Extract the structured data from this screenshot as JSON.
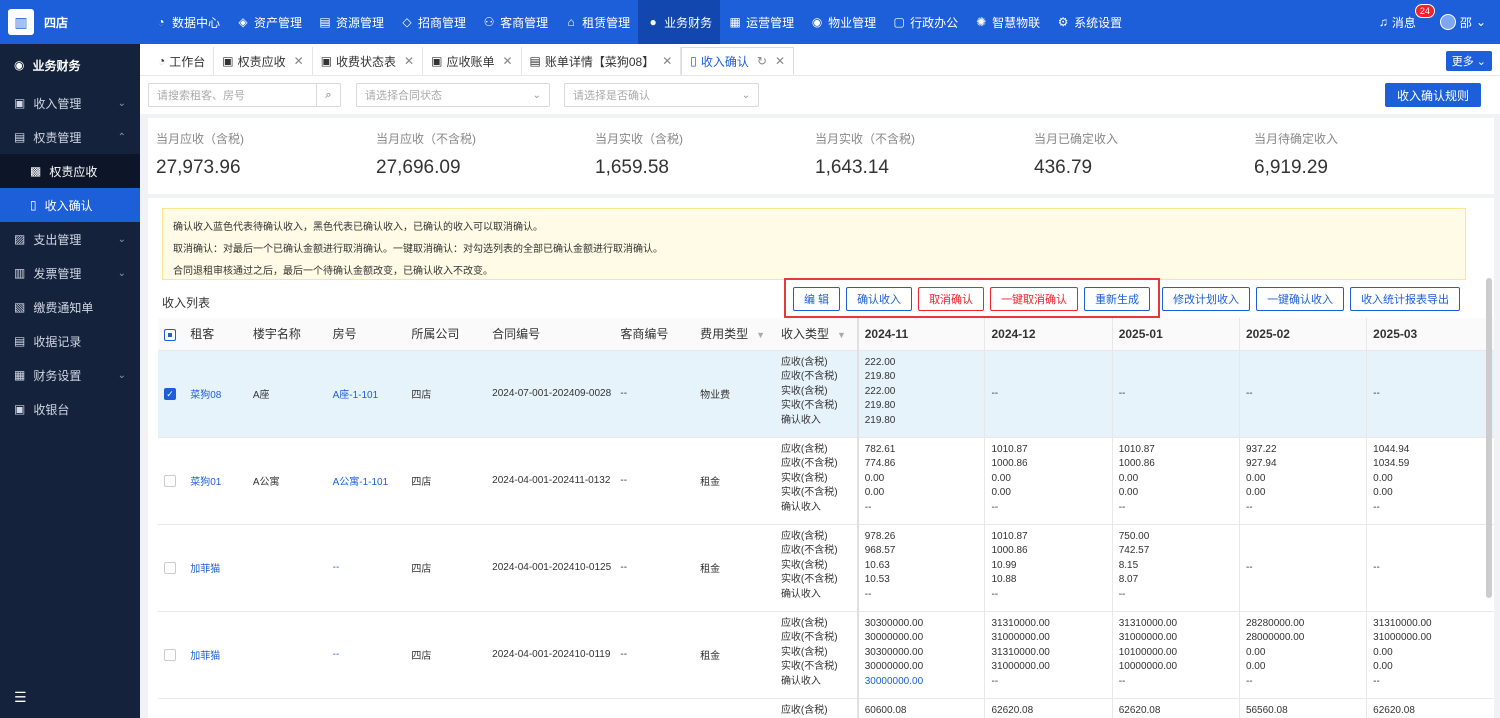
{
  "app": {
    "name": "四店",
    "logo_icon": "building-icon"
  },
  "topnav": [
    {
      "icon": "◔",
      "label": "数据中心"
    },
    {
      "icon": "◈",
      "label": "资产管理"
    },
    {
      "icon": "▤",
      "label": "资源管理"
    },
    {
      "icon": "◇",
      "label": "招商管理"
    },
    {
      "icon": "⚇",
      "label": "客商管理"
    },
    {
      "icon": "⌂",
      "label": "租赁管理"
    },
    {
      "icon": "●",
      "label": "业务财务"
    },
    {
      "icon": "▦",
      "label": "运营管理"
    },
    {
      "icon": "◉",
      "label": "物业管理"
    },
    {
      "icon": "▢",
      "label": "行政办公"
    },
    {
      "icon": "✺",
      "label": "智慧物联"
    },
    {
      "icon": "⚙",
      "label": "系统设置"
    }
  ],
  "topright": {
    "message": "消息",
    "badge": "24",
    "user": "邵"
  },
  "sidebar": {
    "title": "业务财务",
    "items": [
      {
        "label": "收入管理",
        "icon": "▣",
        "arrow": "⌄"
      },
      {
        "label": "权责管理",
        "icon": "▤",
        "arrow": "⌃"
      },
      {
        "label": "支出管理",
        "icon": "▨",
        "arrow": "⌄"
      },
      {
        "label": "发票管理",
        "icon": "▥",
        "arrow": "⌄"
      },
      {
        "label": "缴费通知单",
        "icon": "▧",
        "arrow": ""
      },
      {
        "label": "收据记录",
        "icon": "▤",
        "arrow": ""
      },
      {
        "label": "财务设置",
        "icon": "▦",
        "arrow": "⌄"
      },
      {
        "label": "收银台",
        "icon": "▣",
        "arrow": ""
      }
    ],
    "subitems": [
      {
        "label": "权责应收",
        "icon": "▩"
      },
      {
        "label": "收入确认",
        "icon": "▯"
      }
    ]
  },
  "tabs": [
    {
      "label": "工作台",
      "icon": "◔"
    },
    {
      "label": "权责应收",
      "icon": "▣"
    },
    {
      "label": "收费状态表",
      "icon": "▣"
    },
    {
      "label": "应收账单",
      "icon": "▣"
    },
    {
      "label": "账单详情【菜狗08】",
      "icon": "▤"
    },
    {
      "label": "收入确认",
      "icon": "▯"
    }
  ],
  "more": "更多",
  "filters": {
    "search": "请搜索租客、房号",
    "contract": "请选择合同状态",
    "confirm": "请选择是否确认",
    "rule_btn": "收入确认规则"
  },
  "stats": [
    {
      "label": "当月应收（含税)",
      "value": "27,973.96"
    },
    {
      "label": "当月应收（不含税)",
      "value": "27,696.09"
    },
    {
      "label": "当月实收（含税)",
      "value": "1,659.58"
    },
    {
      "label": "当月实收（不含税)",
      "value": "1,643.14"
    },
    {
      "label": "当月已确定收入",
      "value": "436.79"
    },
    {
      "label": "当月待确定收入",
      "value": "6,919.29"
    }
  ],
  "notice": [
    "确认收入蓝色代表待确认收入，黑色代表已确认收入，已确认的收入可以取消确认。",
    "取消确认：对最后一个已确认金额进行取消确认。一键取消确认：对勾选列表的全部已确认金额进行取消确认。",
    "合同退租审核通过之后，最后一个待确认金额改变，已确认收入不改变。"
  ],
  "list_title": "收入列表",
  "buttons": [
    {
      "label": "编 辑",
      "style": "blue"
    },
    {
      "label": "确认收入",
      "style": "blue"
    },
    {
      "label": "取消确认",
      "style": "red"
    },
    {
      "label": "一键取消确认",
      "style": "red"
    },
    {
      "label": "重新生成",
      "style": "blue"
    },
    {
      "label": "修改计划收入",
      "style": "blue"
    },
    {
      "label": "一键确认收入",
      "style": "blue"
    },
    {
      "label": "收入统计报表导出",
      "style": "blue"
    }
  ],
  "columns": [
    "租客",
    "楼宇名称",
    "房号",
    "所属公司",
    "合同编号",
    "客商编号",
    "费用类型",
    "收入类型",
    "2024-11",
    "2024-12",
    "2025-01",
    "2025-02",
    "2025-03"
  ],
  "income_types": [
    "应收(含税)",
    "应收(不含税)",
    "实收(含税)",
    "实收(不含税)",
    "确认收入"
  ],
  "rows": [
    {
      "selected": true,
      "tenant": "菜狗08",
      "building": "A座",
      "room": "A座-1-101",
      "company": "四店",
      "contract": "2024-07-001-202409-0028",
      "merchant": "--",
      "fee": "物业费",
      "months": [
        [
          "222.00",
          "219.80",
          "222.00",
          "219.80",
          "219.80"
        ],
        [
          "--"
        ],
        [
          "--"
        ],
        [
          "--"
        ],
        [
          "--"
        ]
      ]
    },
    {
      "selected": false,
      "tenant": "菜狗01",
      "building": "A公寓",
      "room": "A公寓-1-101",
      "company": "四店",
      "contract": "2024-04-001-202411-0132",
      "merchant": "--",
      "fee": "租金",
      "months": [
        [
          "782.61",
          "774.86",
          "0.00",
          "0.00",
          "--"
        ],
        [
          "1010.87",
          "1000.86",
          "0.00",
          "0.00",
          "--"
        ],
        [
          "1010.87",
          "1000.86",
          "0.00",
          "0.00",
          "--"
        ],
        [
          "937.22",
          "927.94",
          "0.00",
          "0.00",
          "--"
        ],
        [
          "1044.94",
          "1034.59",
          "0.00",
          "0.00",
          "--"
        ]
      ]
    },
    {
      "selected": false,
      "tenant": "加菲猫",
      "building": "",
      "room": "--",
      "company": "四店",
      "contract": "2024-04-001-202410-0125",
      "merchant": "--",
      "fee": "租金",
      "months": [
        [
          "978.26",
          "968.57",
          "10.63",
          "10.53",
          "--"
        ],
        [
          "1010.87",
          "1000.86",
          "10.99",
          "10.88",
          "--"
        ],
        [
          "750.00",
          "742.57",
          "8.15",
          "8.07",
          "--"
        ],
        [
          "--"
        ],
        [
          "--"
        ]
      ]
    },
    {
      "selected": false,
      "tenant": "加菲猫",
      "building": "",
      "room": "--",
      "company": "四店",
      "contract": "2024-04-001-202410-0119",
      "merchant": "--",
      "fee": "租金",
      "months": [
        [
          "30300000.00",
          "30000000.00",
          "30300000.00",
          "30000000.00",
          "30000000.00"
        ],
        [
          "31310000.00",
          "31000000.00",
          "31310000.00",
          "31000000.00",
          "--"
        ],
        [
          "31310000.00",
          "31000000.00",
          "10100000.00",
          "10000000.00",
          "--"
        ],
        [
          "28280000.00",
          "28000000.00",
          "0.00",
          "0.00",
          "--"
        ],
        [
          "31310000.00",
          "31000000.00",
          "0.00",
          "0.00",
          "--"
        ]
      ],
      "pending_first": true
    },
    {
      "selected": false,
      "tenant": "",
      "building": "",
      "room": "",
      "company": "",
      "contract": "",
      "merchant": "",
      "fee": "",
      "months": [
        [
          "60600.08"
        ],
        [
          "62620.08"
        ],
        [
          "62620.08"
        ],
        [
          "56560.08"
        ],
        [
          "62620.08"
        ]
      ],
      "partial": true
    }
  ]
}
